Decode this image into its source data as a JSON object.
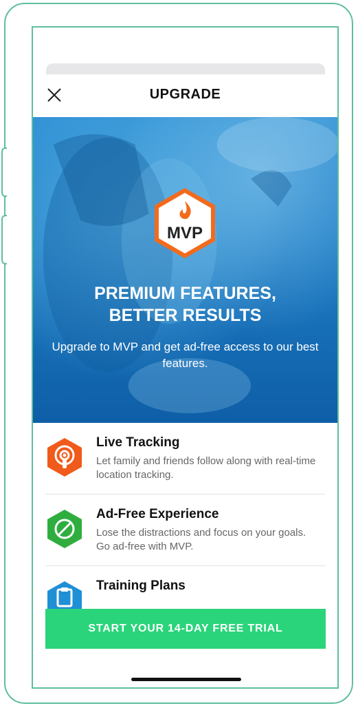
{
  "header": {
    "title": "UPGRADE",
    "close_icon": "close-icon"
  },
  "hero": {
    "badge_label": "MVP",
    "headline_line1": "PREMIUM FEATURES,",
    "headline_line2": "BETTER RESULTS",
    "subtitle": "Upgrade to MVP and get ad-free access to our best features."
  },
  "features": [
    {
      "title": "Live Tracking",
      "description": "Let family and friends follow along with real-time location tracking.",
      "icon": "live-tracking-icon",
      "color": "#f05a1a"
    },
    {
      "title": "Ad-Free Experience",
      "description": "Lose the distractions and focus on your goals. Go ad-free with MVP.",
      "icon": "ad-free-icon",
      "color": "#2fae3f"
    },
    {
      "title": "Training Plans",
      "description": "",
      "icon": "training-plans-icon",
      "color": "#1f8fd6"
    }
  ],
  "cta": {
    "label": "START YOUR 14-DAY FREE TRIAL",
    "color": "#2ad47a"
  },
  "colors": {
    "frame": "#5dbf9c",
    "hero_blue": "#1f7ec6",
    "badge_orange": "#f26b1d"
  }
}
